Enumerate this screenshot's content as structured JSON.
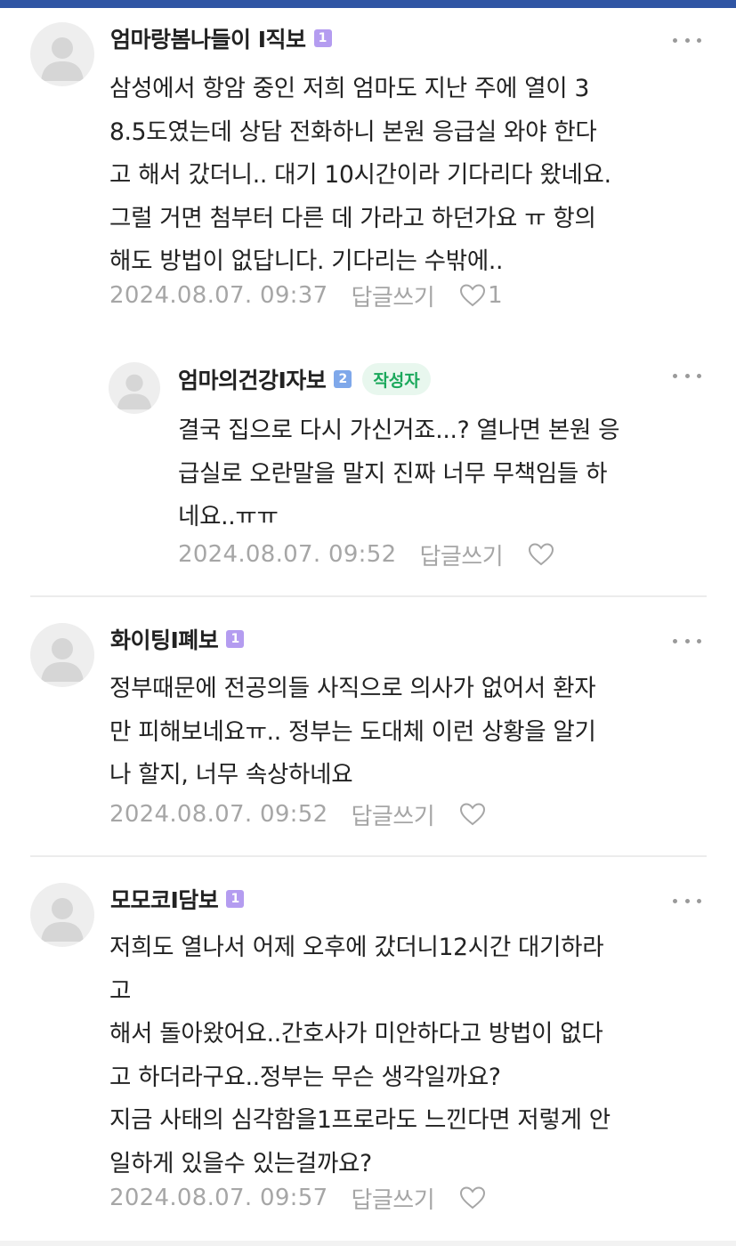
{
  "colors": {
    "top_accent": "#2f55a4",
    "badge_purple": "#b49cf0",
    "badge_blue": "#7fa8ea",
    "author_tag_bg": "#e8f7ee",
    "author_tag_text": "#1aa85b",
    "muted_text": "#a6a6a6"
  },
  "labels": {
    "reply": "답글쓰기"
  },
  "comments": [
    {
      "nickname": "엄마랑봄나들이 I직보",
      "badge": "1",
      "text_lines": [
        "삼성에서 항암 중인 저희 엄마도 지난 주에 열이 3",
        "8.5도였는데 상담 전화하니 본원 응급실 와야 한다",
        "고 해서 갔더니.. 대기 10시간이라 기다리다 왔네요.",
        "그럴 거면 첨부터 다른 데 가라고 하던가요 ㅠ 항의",
        "해도 방법이 없답니다. 기다리는 수밖에.."
      ],
      "date": "2024.08.07. 09:37",
      "like_icon": "heart-outline-icon",
      "like_count": "1"
    },
    {
      "nickname": "엄마의건강I자보",
      "badge": "2",
      "author_tag": "작성자",
      "text_lines": [
        "결국 집으로 다시 가신거죠...? 열나면 본원 응",
        "급실로 오란말을 말지 진짜 너무 무책임들 하",
        "네요..ㅠㅠ"
      ],
      "date": "2024.08.07. 09:52",
      "like_icon": "heart-outline-icon"
    },
    {
      "nickname": "화이팅I폐보",
      "badge": "1",
      "text_lines": [
        "정부때문에 전공의들 사직으로 의사가 없어서 환자",
        "만 피해보네요ㅠ.. 정부는 도대체 이런 상황을 알기",
        "나 할지, 너무 속상하네요"
      ],
      "date": "2024.08.07. 09:52",
      "like_icon": "heart-outline-icon"
    },
    {
      "nickname": "모모코I담보",
      "badge": "1",
      "text_lines": [
        "저희도 열나서 어제 오후에 갔더니12시간 대기하라",
        "고",
        "해서 돌아왔어요..간호사가 미안하다고 방법이 없다",
        "고 하더라구요..정부는 무슨 생각일까요?",
        "지금 사태의 심각함을1프로라도 느낀다면 저렇게 안",
        "일하게 있을수 있는걸까요?"
      ],
      "date": "2024.08.07. 09:57",
      "like_icon": "heart-outline-icon"
    }
  ]
}
